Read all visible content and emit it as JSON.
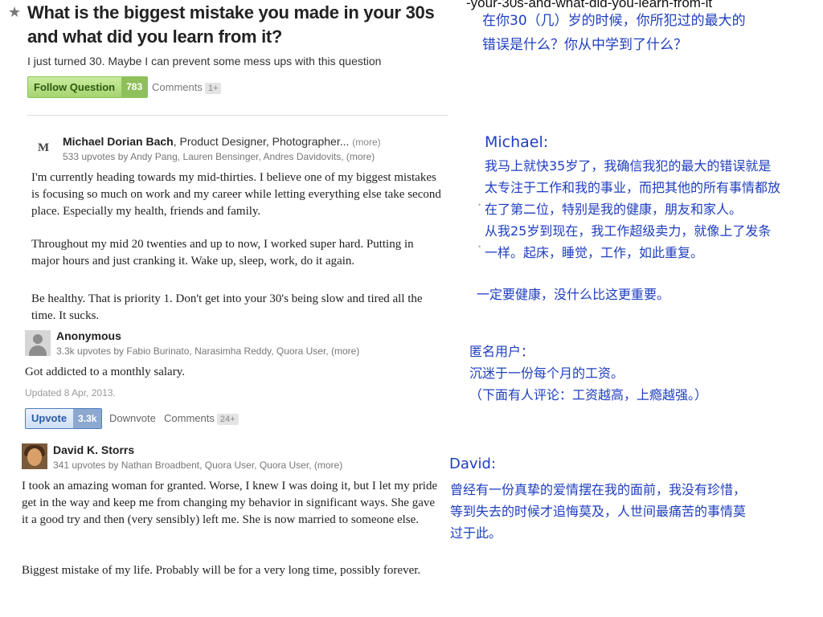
{
  "question": {
    "title": "What is the biggest mistake you made in your 30s and what did you learn from it?",
    "detail": "I just turned 30. Maybe I can prevent some mess ups with this question",
    "follow_label": "Follow Question",
    "follow_count": "783",
    "comments_label": "Comments",
    "comments_count": "1+",
    "url_fragment": "-your-30s-and-what-did-you-learn-from-it"
  },
  "answers": [
    {
      "avatar_letter": "M",
      "name": "Michael Dorian Bach",
      "credential": ", Product Designer, Photographer...",
      "more": "(more)",
      "upvotes": "533 upvotes by Andy Pang, Lauren Bensinger, Andres Davidovits, (more)",
      "paragraphs": [
        "I'm currently heading towards my mid-thirties. I believe one of my biggest mistakes is focusing so much on work and my career while letting everything else take second place. Especially my health, friends and family.",
        "Throughout my mid 20 twenties and up to now, I worked super hard. Putting in major hours and just cranking it. Wake up, sleep, work, do it again.",
        "Be healthy. That is priority 1. Don't get into your 30's being slow and tired all the time. It sucks."
      ]
    },
    {
      "name": "Anonymous",
      "upvotes": "3.3k upvotes by Fabio Burinato, Narasimha Reddy, Quora User, (more)",
      "text": "Got addicted to a monthly salary.",
      "updated": "Updated 8 Apr, 2013.",
      "upvote_label": "Upvote",
      "upvote_count": "3.3k",
      "downvote_label": "Downvote",
      "comments_label": "Comments",
      "comments_count": "24+"
    },
    {
      "name": "David K. Storrs",
      "upvotes": "341 upvotes by Nathan Broadbent, Quora User, Quora User, (more)",
      "paragraphs": [
        "I took an amazing woman for granted.  Worse, I knew I was doing it, but I let my pride get in the way and keep me from changing my behavior in significant ways.  She gave it a good try and then (very sensibly) left me.  She is now married to someone else.",
        "Biggest mistake of my life.  Probably will be for a very long time, possibly forever."
      ]
    }
  ],
  "translations": {
    "question": [
      "在你30（几）岁的时候，你所犯过的最大的",
      "错误是什么？你从中学到了什么？"
    ],
    "michael_name": "Michael:",
    "michael": [
      "我马上就快35岁了，我确信我犯的最大的错误就是",
      "太专注于工作和我的事业，而把其他的所有事情都放",
      "在了第二位，特别是我的健康，朋友和家人。",
      "从我25岁到现在，我工作超级卖力，就像上了发条",
      "一样。起床，睡觉，工作，如此重复。"
    ],
    "michael_last": "一定要健康，没什么比这更重要。",
    "anon": [
      "匿名用户：",
      "沉迷于一份每个月的工资。",
      "（下面有人评论：工资越高，上瘾越强。）"
    ],
    "david_name": "David:",
    "david": [
      "曾经有一份真挚的爱情摆在我的面前，我没有珍惜，",
      "等到失去的时候才追悔莫及，人世间最痛苦的事情莫",
      "过于此。"
    ]
  }
}
